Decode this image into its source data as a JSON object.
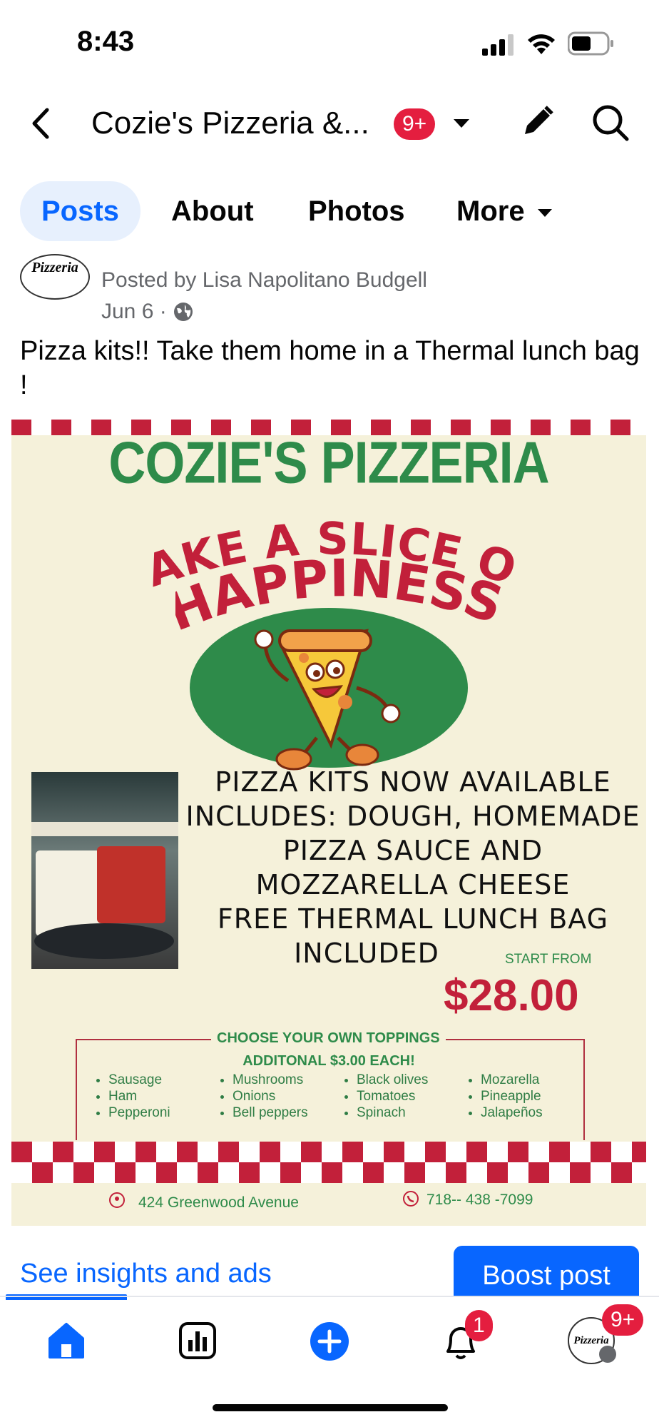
{
  "status_bar": {
    "time": "8:43"
  },
  "header": {
    "title": "Cozie's Pizzeria &...",
    "notifications_badge": "9+"
  },
  "tabs": [
    {
      "label": "Posts",
      "active": true
    },
    {
      "label": "About"
    },
    {
      "label": "Photos"
    },
    {
      "label": "More"
    }
  ],
  "post": {
    "author_line": "Posted by Lisa Napolitano Budgell",
    "date": "Jun 6",
    "separator": "·",
    "text": "Pizza kits!!   Take them home in a Thermal lunch bag !",
    "avatar_text": "Pizzeria"
  },
  "poster": {
    "title": "COZIE'S PIZZERIA",
    "headline_line1": "MAKE A SLICE OF",
    "headline_line2": "HAPPINESS",
    "kit_lines": [
      "PIZZA KITS NOW AVAILABLE",
      "INCLUDES: DOUGH, HOMEMADE",
      "PIZZA SAUCE AND",
      "MOZZARELLA CHEESE",
      "FREE THERMAL LUNCH BAG",
      "INCLUDED"
    ],
    "start_from": "START FROM",
    "price": "$28.00",
    "toppings_heading": "CHOOSE YOUR OWN TOPPINGS",
    "toppings_subheading": "ADDITONAL $3.00 EACH!",
    "toppings_columns": [
      [
        "Sausage",
        "Ham",
        "Pepperoni"
      ],
      [
        "Mushrooms",
        "Onions",
        "Bell peppers"
      ],
      [
        "Black olives",
        "Tomatoes",
        "Spinach"
      ],
      [
        "Mozarella",
        "Pineapple",
        "Jalapeños"
      ]
    ],
    "address": "424 Greenwood Avenue",
    "phone": "718-- 438 -7099",
    "colors": {
      "green": "#2e8b4a",
      "red": "#c2203a",
      "cream": "#f5f1da"
    }
  },
  "actions": {
    "insights": "See insights and ads",
    "boost": "Boost post"
  },
  "bottom_nav": {
    "items": [
      {
        "icon": "home-icon",
        "active": true
      },
      {
        "icon": "insights-chart-icon"
      },
      {
        "icon": "create-plus-icon"
      },
      {
        "icon": "notifications-bell-icon",
        "badge": "1"
      },
      {
        "icon": "profile-avatar-icon",
        "badge": "9+"
      }
    ]
  },
  "accent": "#0866ff"
}
